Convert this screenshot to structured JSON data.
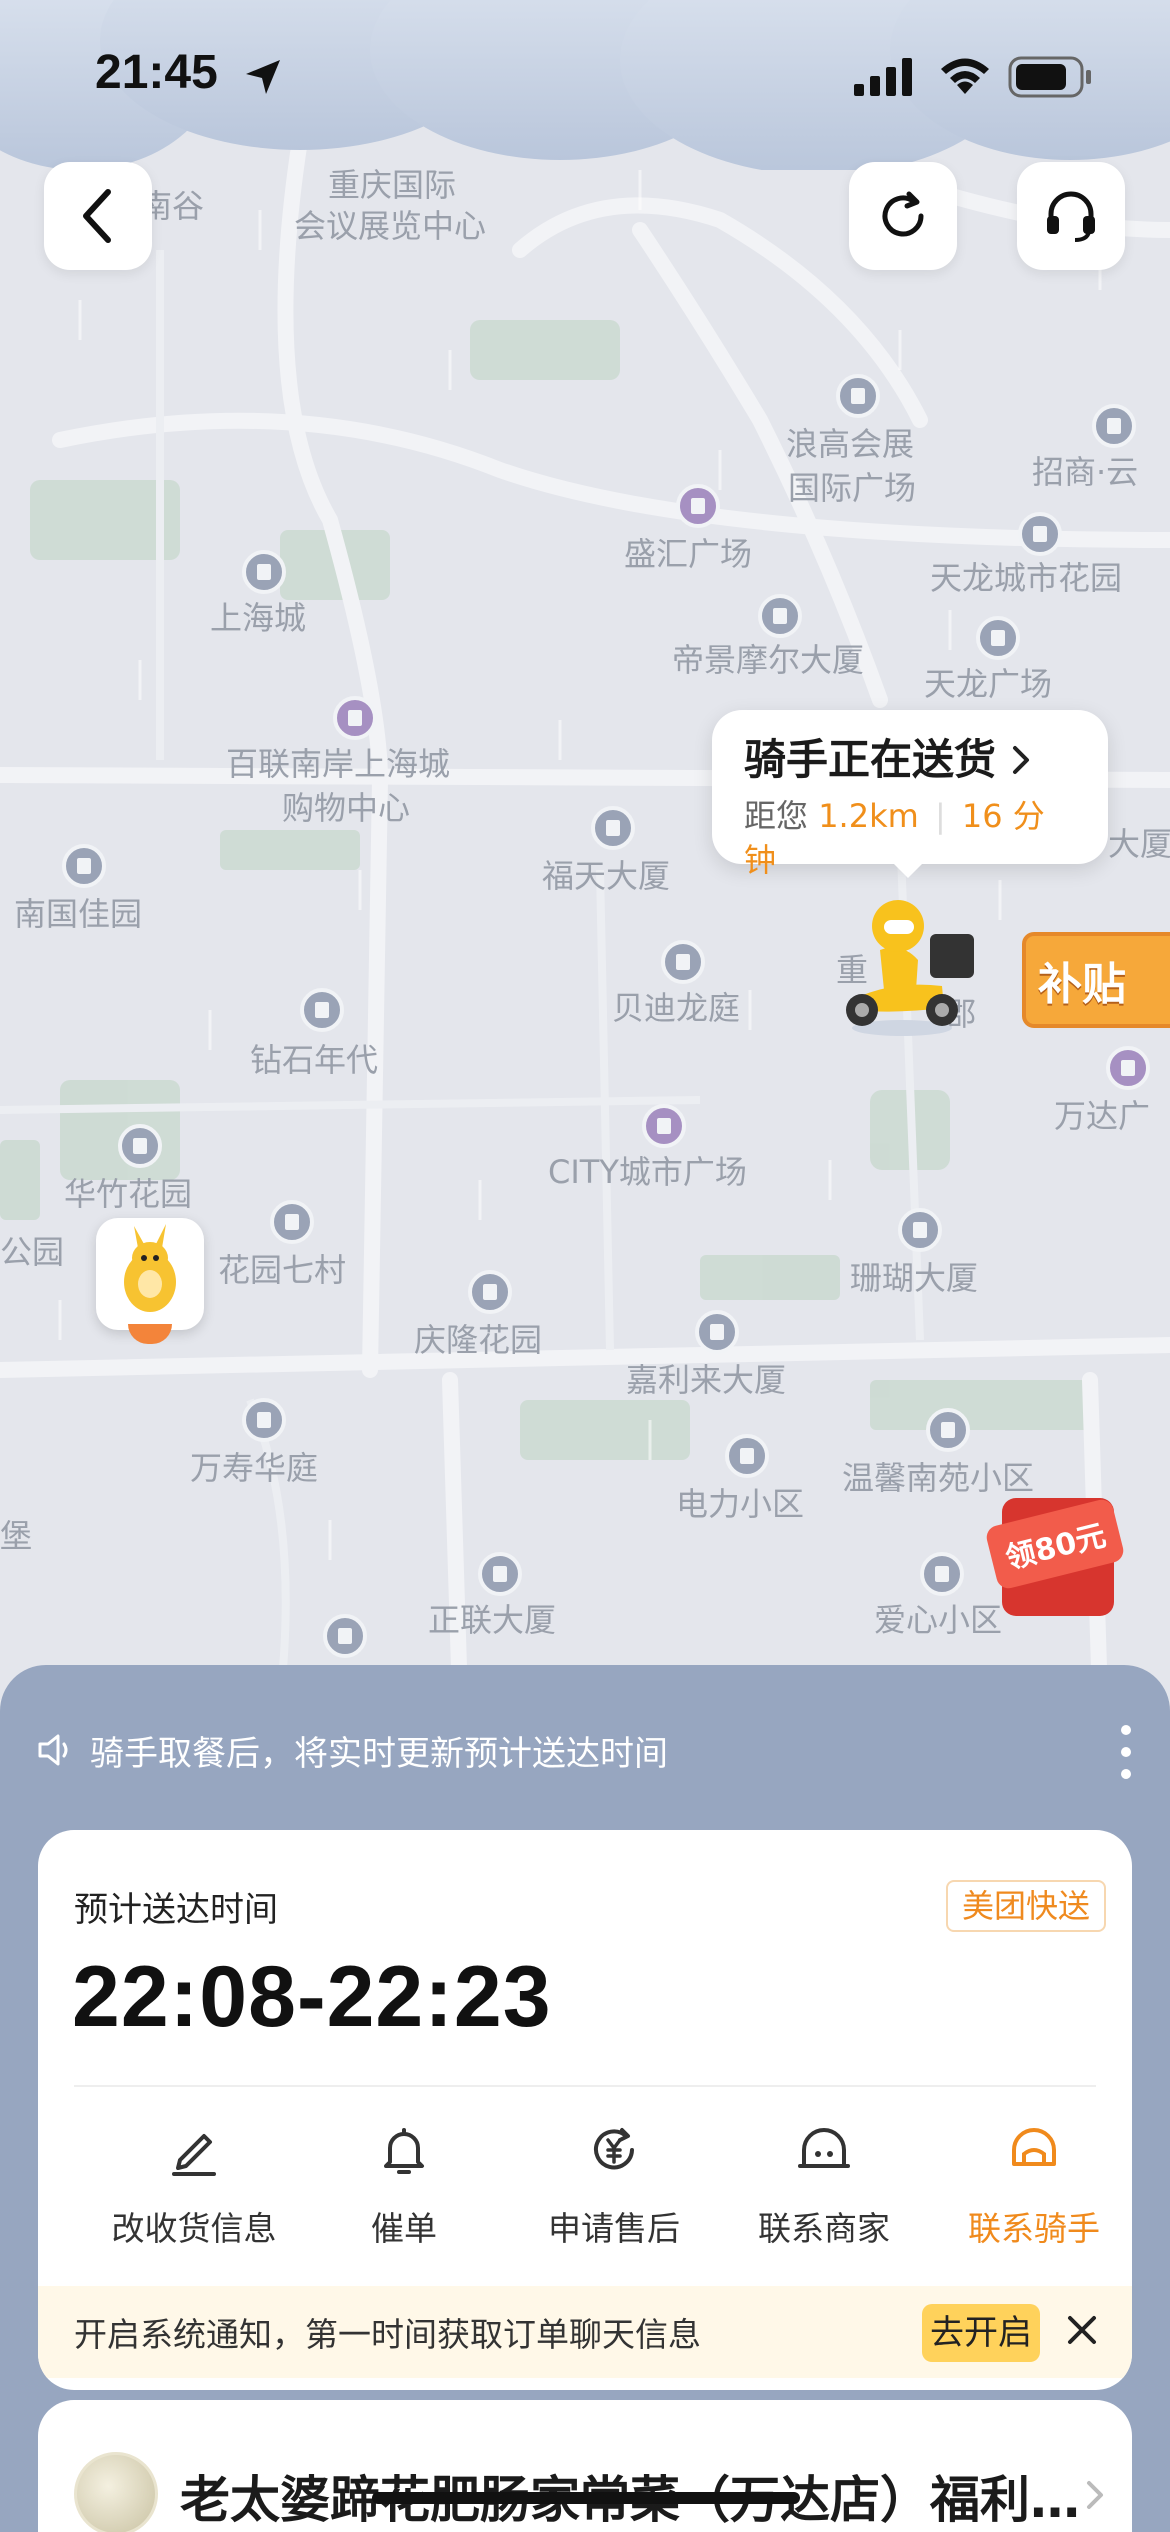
{
  "status_bar": {
    "time": "21:45"
  },
  "map": {
    "places": [
      "重庆国际",
      "会议展览中心",
      "南谷",
      "浪高会展",
      "国际广场",
      "招商·云",
      "盛汇广场",
      "天龙城市花园",
      "上海城",
      "帝景摩尔大厦",
      "天龙广场",
      "百联南岸上海城",
      "购物中心",
      "福天大厦",
      "南国佳园",
      "大厦",
      "贝迪龙庭",
      "钻石年代",
      "万达广",
      "华竹花园",
      "CITY城市广场",
      "公园",
      "花园七村",
      "珊瑚大厦",
      "庆隆花园",
      "嘉利来大厦",
      "万寿华庭",
      "温馨南苑小区",
      "电力小区",
      "堡",
      "正联大厦",
      "爱心小区",
      "重",
      "郡"
    ],
    "subsidy_badge": "补贴",
    "coupon_badge": "领80元"
  },
  "rider_bubble": {
    "title": "骑手正在送货",
    "distance_prefix": "距您",
    "distance": "1.2km",
    "eta_minutes": "16 分钟"
  },
  "notice": {
    "text": "骑手取餐后，将实时更新预计送达时间"
  },
  "eta_card": {
    "label": "预计送达时间",
    "badge": "美团快送",
    "time_range": "22:08-22:23",
    "actions": [
      {
        "label": "改收货信息",
        "icon": "edit-icon"
      },
      {
        "label": "催单",
        "icon": "bell-icon"
      },
      {
        "label": "申请售后",
        "icon": "refund-icon"
      },
      {
        "label": "联系商家",
        "icon": "merchant-icon"
      },
      {
        "label": "联系骑手",
        "icon": "rider-helmet-icon"
      }
    ],
    "notification": {
      "text": "开启系统通知，第一时间获取订单聊天信息",
      "button": "去开启"
    }
  },
  "shop": {
    "name": "老太婆蹄花肥肠家常菜（万达店）福利…"
  },
  "colors": {
    "accent_orange": "#f08a1c",
    "sheet_bg": "#97a6c0",
    "notify_bg": "#fff8e8",
    "go_btn": "#ffd25b"
  }
}
